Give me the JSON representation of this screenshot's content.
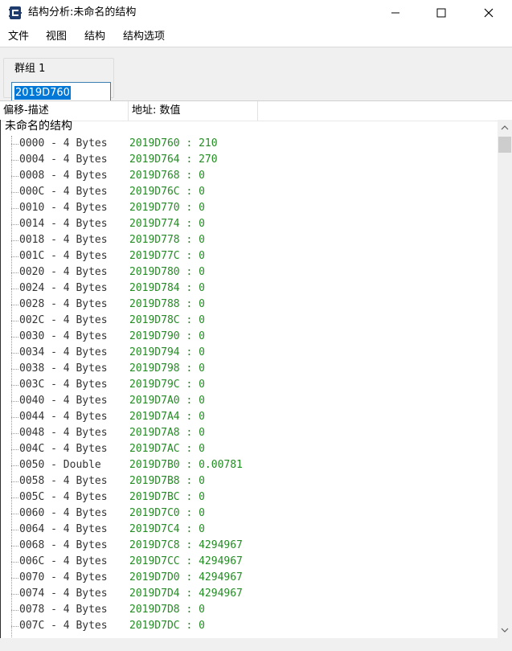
{
  "window": {
    "title": "结构分析:未命名的结构",
    "icon": "cheat-engine-icon"
  },
  "menu": [
    "文件",
    "视图",
    "结构",
    "结构选项"
  ],
  "group": {
    "label": "群组 1",
    "address": "2019D760"
  },
  "columns": {
    "offset_desc": "偏移-描述",
    "address_value": "地址: 数值"
  },
  "structure": {
    "name": "未命名的结构",
    "rows": [
      {
        "desc": "0000 - 4 Bytes",
        "value": "2019D760 : 210"
      },
      {
        "desc": "0004 - 4 Bytes",
        "value": "2019D764 : 270"
      },
      {
        "desc": "0008 - 4 Bytes",
        "value": "2019D768 : 0"
      },
      {
        "desc": "000C - 4 Bytes",
        "value": "2019D76C : 0"
      },
      {
        "desc": "0010 - 4 Bytes",
        "value": "2019D770 : 0"
      },
      {
        "desc": "0014 - 4 Bytes",
        "value": "2019D774 : 0"
      },
      {
        "desc": "0018 - 4 Bytes",
        "value": "2019D778 : 0"
      },
      {
        "desc": "001C - 4 Bytes",
        "value": "2019D77C : 0"
      },
      {
        "desc": "0020 - 4 Bytes",
        "value": "2019D780 : 0"
      },
      {
        "desc": "0024 - 4 Bytes",
        "value": "2019D784 : 0"
      },
      {
        "desc": "0028 - 4 Bytes",
        "value": "2019D788 : 0"
      },
      {
        "desc": "002C - 4 Bytes",
        "value": "2019D78C : 0"
      },
      {
        "desc": "0030 - 4 Bytes",
        "value": "2019D790 : 0"
      },
      {
        "desc": "0034 - 4 Bytes",
        "value": "2019D794 : 0"
      },
      {
        "desc": "0038 - 4 Bytes",
        "value": "2019D798 : 0"
      },
      {
        "desc": "003C - 4 Bytes",
        "value": "2019D79C : 0"
      },
      {
        "desc": "0040 - 4 Bytes",
        "value": "2019D7A0 : 0"
      },
      {
        "desc": "0044 - 4 Bytes",
        "value": "2019D7A4 : 0"
      },
      {
        "desc": "0048 - 4 Bytes",
        "value": "2019D7A8 : 0"
      },
      {
        "desc": "004C - 4 Bytes",
        "value": "2019D7AC : 0"
      },
      {
        "desc": "0050 - Double",
        "value": "2019D7B0 : 0.00781"
      },
      {
        "desc": "0058 - 4 Bytes",
        "value": "2019D7B8 : 0"
      },
      {
        "desc": "005C - 4 Bytes",
        "value": "2019D7BC : 0"
      },
      {
        "desc": "0060 - 4 Bytes",
        "value": "2019D7C0 : 0"
      },
      {
        "desc": "0064 - 4 Bytes",
        "value": "2019D7C4 : 0"
      },
      {
        "desc": "0068 - 4 Bytes",
        "value": "2019D7C8 : 4294967"
      },
      {
        "desc": "006C - 4 Bytes",
        "value": "2019D7CC : 4294967"
      },
      {
        "desc": "0070 - 4 Bytes",
        "value": "2019D7D0 : 4294967"
      },
      {
        "desc": "0074 - 4 Bytes",
        "value": "2019D7D4 : 4294967"
      },
      {
        "desc": "0078 - 4 Bytes",
        "value": "2019D7D8 : 0"
      },
      {
        "desc": "007C - 4 Bytes",
        "value": "2019D7DC : 0"
      }
    ]
  },
  "colors": {
    "value_text": "#238c23",
    "selection": "#0078d7"
  }
}
